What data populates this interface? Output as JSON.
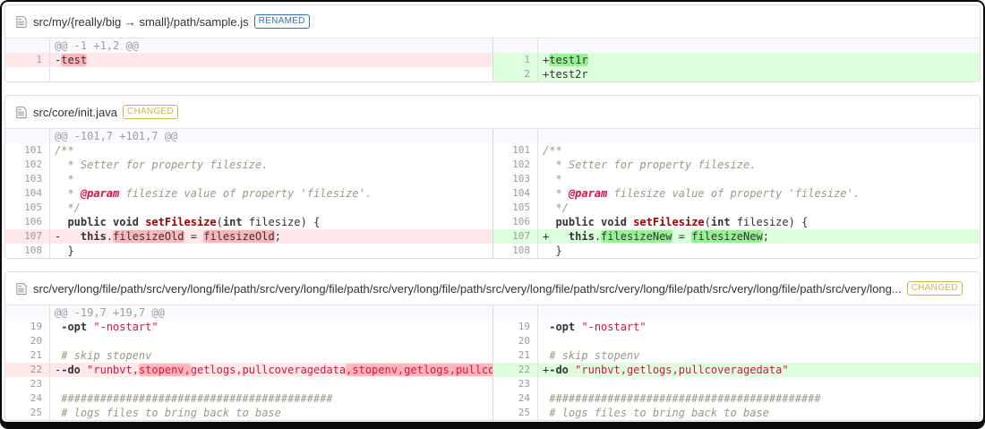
{
  "colors": {
    "renamed_tag": "#3572b0",
    "changed_tag": "#d0b44c",
    "deletion_line_bg": "#fee8e9",
    "deletion_word_bg": "#ffb6ba",
    "insertion_line_bg": "#ddffdd",
    "insertion_word_bg": "#97f295",
    "hunk_header_bg": "#f8fafd"
  },
  "files": [
    {
      "name": "src/my/{really/big → small}/path/sample.js",
      "tag": "RENAMED",
      "tag_style": "renamed",
      "left": [
        {
          "t": "info",
          "text": "@@ -1 +1,2 @@"
        },
        {
          "t": "del",
          "n": "1",
          "s": [
            [
              "-",
              ""
            ],
            [
              "test",
              "hd"
            ]
          ]
        },
        {
          "t": "empty"
        }
      ],
      "right": [
        {
          "t": "info",
          "text": ""
        },
        {
          "t": "ins",
          "n": "1",
          "s": [
            [
              "+",
              ""
            ],
            [
              "test1r",
              "hi"
            ]
          ]
        },
        {
          "t": "ins",
          "n": "2",
          "s": [
            [
              "+test2r",
              ""
            ]
          ]
        }
      ]
    },
    {
      "name": "src/core/init.java",
      "tag": "CHANGED",
      "tag_style": "changed",
      "left": [
        {
          "t": "info",
          "text": "@@ -101,7 +101,7 @@"
        },
        {
          "t": "ctx",
          "n": "101",
          "s": [
            [
              "/**",
              "cmt"
            ]
          ]
        },
        {
          "t": "ctx",
          "n": "102",
          "s": [
            [
              "  * Setter for property filesize.",
              "cmt"
            ]
          ]
        },
        {
          "t": "ctx",
          "n": "103",
          "s": [
            [
              "  *",
              "cmt"
            ]
          ]
        },
        {
          "t": "ctx",
          "n": "104",
          "s": [
            [
              "  * ",
              "cmt"
            ],
            [
              "@param",
              "dt"
            ],
            [
              " filesize value of property 'filesize'.",
              "cmt"
            ]
          ]
        },
        {
          "t": "ctx",
          "n": "105",
          "s": [
            [
              "  */",
              "cmt"
            ]
          ]
        },
        {
          "t": "ctx",
          "n": "106",
          "s": [
            [
              "  ",
              ""
            ],
            [
              "public",
              "kw"
            ],
            [
              " ",
              ""
            ],
            [
              "void",
              "kw"
            ],
            [
              " ",
              ""
            ],
            [
              "setFilesize",
              "fn"
            ],
            [
              "(",
              ""
            ],
            [
              "int",
              "kw"
            ],
            [
              " filesize) {",
              ""
            ]
          ]
        },
        {
          "t": "del",
          "n": "107",
          "s": [
            [
              "-   ",
              ""
            ],
            [
              "this",
              "kw"
            ],
            [
              ".",
              ""
            ],
            [
              "filesizeOld",
              "hd"
            ],
            [
              " = ",
              ""
            ],
            [
              "filesizeOld",
              "hd"
            ],
            [
              ";",
              ""
            ]
          ]
        },
        {
          "t": "ctx",
          "n": "108",
          "s": [
            [
              "  }",
              ""
            ]
          ]
        }
      ],
      "right": [
        {
          "t": "info",
          "text": ""
        },
        {
          "t": "ctx",
          "n": "101",
          "s": [
            [
              "/**",
              "cmt"
            ]
          ]
        },
        {
          "t": "ctx",
          "n": "102",
          "s": [
            [
              "  * Setter for property filesize.",
              "cmt"
            ]
          ]
        },
        {
          "t": "ctx",
          "n": "103",
          "s": [
            [
              "  *",
              "cmt"
            ]
          ]
        },
        {
          "t": "ctx",
          "n": "104",
          "s": [
            [
              "  * ",
              "cmt"
            ],
            [
              "@param",
              "dt"
            ],
            [
              " filesize value of property 'filesize'.",
              "cmt"
            ]
          ]
        },
        {
          "t": "ctx",
          "n": "105",
          "s": [
            [
              "  */",
              "cmt"
            ]
          ]
        },
        {
          "t": "ctx",
          "n": "106",
          "s": [
            [
              "  ",
              ""
            ],
            [
              "public",
              "kw"
            ],
            [
              " ",
              ""
            ],
            [
              "void",
              "kw"
            ],
            [
              " ",
              ""
            ],
            [
              "setFilesize",
              "fn"
            ],
            [
              "(",
              ""
            ],
            [
              "int",
              "kw"
            ],
            [
              " filesize) {",
              ""
            ]
          ]
        },
        {
          "t": "ins",
          "n": "107",
          "s": [
            [
              "+   ",
              ""
            ],
            [
              "this",
              "kw"
            ],
            [
              ".",
              ""
            ],
            [
              "filesizeNew",
              "hi"
            ],
            [
              " = ",
              ""
            ],
            [
              "filesizeNew",
              "hi"
            ],
            [
              ";",
              ""
            ]
          ]
        },
        {
          "t": "ctx",
          "n": "108",
          "s": [
            [
              "  }",
              ""
            ]
          ]
        }
      ]
    },
    {
      "name": "src/very/long/file/path/src/very/long/file/path/src/very/long/file/path/src/very/long/file/path/src/very/long/file/path/src/very/long/file/path/src/very/long/file/path/src/very/long...",
      "tag": "CHANGED",
      "tag_style": "changed",
      "left": [
        {
          "t": "info",
          "text": "@@ -19,7 +19,7 @@"
        },
        {
          "t": "ctx",
          "n": "19",
          "s": [
            [
              " ",
              ""
            ],
            [
              "-opt",
              "kw"
            ],
            [
              " ",
              ""
            ],
            [
              "\"-nostart\"",
              "str"
            ]
          ]
        },
        {
          "t": "ctx",
          "n": "20",
          "s": []
        },
        {
          "t": "ctx",
          "n": "21",
          "s": [
            [
              " # skip stopenv",
              "cmt"
            ]
          ]
        },
        {
          "t": "del",
          "n": "22",
          "s": [
            [
              "-",
              ""
            ],
            [
              "-do",
              "kw"
            ],
            [
              " ",
              ""
            ],
            [
              "\"runbvt,",
              "str"
            ],
            [
              "stopenv,",
              "str hd"
            ],
            [
              "getlogs,pullcoveragedata",
              "str"
            ],
            [
              ",stopenv,getlogs,pullcoveragedata\"",
              "str hd"
            ]
          ]
        },
        {
          "t": "ctx",
          "n": "23",
          "s": []
        },
        {
          "t": "ctx",
          "n": "24",
          "s": [
            [
              " ##########################################",
              "cmt"
            ]
          ]
        },
        {
          "t": "ctx",
          "n": "25",
          "s": [
            [
              " # logs files to bring back to base",
              "cmt"
            ]
          ]
        }
      ],
      "right": [
        {
          "t": "info",
          "text": ""
        },
        {
          "t": "ctx",
          "n": "19",
          "s": [
            [
              " ",
              ""
            ],
            [
              "-opt",
              "kw"
            ],
            [
              " ",
              ""
            ],
            [
              "\"-nostart\"",
              "str"
            ]
          ]
        },
        {
          "t": "ctx",
          "n": "20",
          "s": []
        },
        {
          "t": "ctx",
          "n": "21",
          "s": [
            [
              " # skip stopenv",
              "cmt"
            ]
          ]
        },
        {
          "t": "ins",
          "n": "22",
          "s": [
            [
              "+",
              ""
            ],
            [
              "-do",
              "kw"
            ],
            [
              " ",
              ""
            ],
            [
              "\"runbvt,getlogs,pullcoveragedata\"",
              "str"
            ]
          ]
        },
        {
          "t": "ctx",
          "n": "23",
          "s": []
        },
        {
          "t": "ctx",
          "n": "24",
          "s": [
            [
              " ##########################################",
              "cmt"
            ]
          ]
        },
        {
          "t": "ctx",
          "n": "25",
          "s": [
            [
              " # logs files to bring back to base",
              "cmt"
            ]
          ]
        }
      ]
    }
  ]
}
